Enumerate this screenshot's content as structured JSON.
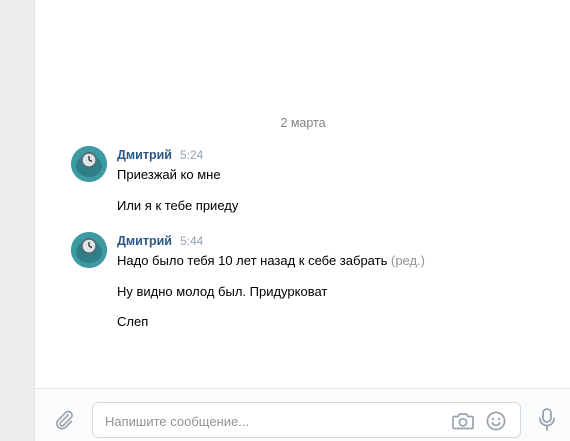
{
  "conversation": {
    "date_separator": "2 марта",
    "groups": [
      {
        "author": "Дмитрий",
        "time": "5:24",
        "messages": [
          {
            "text": "Приезжай ко мне",
            "edited": ""
          },
          {
            "text": "Или я к тебе приеду",
            "edited": ""
          }
        ]
      },
      {
        "author": "Дмитрий",
        "time": "5:44",
        "messages": [
          {
            "text": "Надо было тебя 10 лет назад к себе забрать",
            "edited": "(ред.)"
          },
          {
            "text": "Ну видно молод был. Придурковат",
            "edited": ""
          },
          {
            "text": "Слеп",
            "edited": ""
          }
        ]
      }
    ]
  },
  "composer": {
    "placeholder": "Напишите сообщение...",
    "value": ""
  },
  "icons": {
    "attach": "paperclip-icon",
    "camera": "camera-icon",
    "emoji": "smile-icon",
    "mic": "microphone-icon",
    "avatar": "clock-avatar"
  },
  "colors": {
    "author": "#2a5885",
    "time": "#93a3b6",
    "icon": "#99a2ad",
    "avatar": "#3d9aa2"
  }
}
